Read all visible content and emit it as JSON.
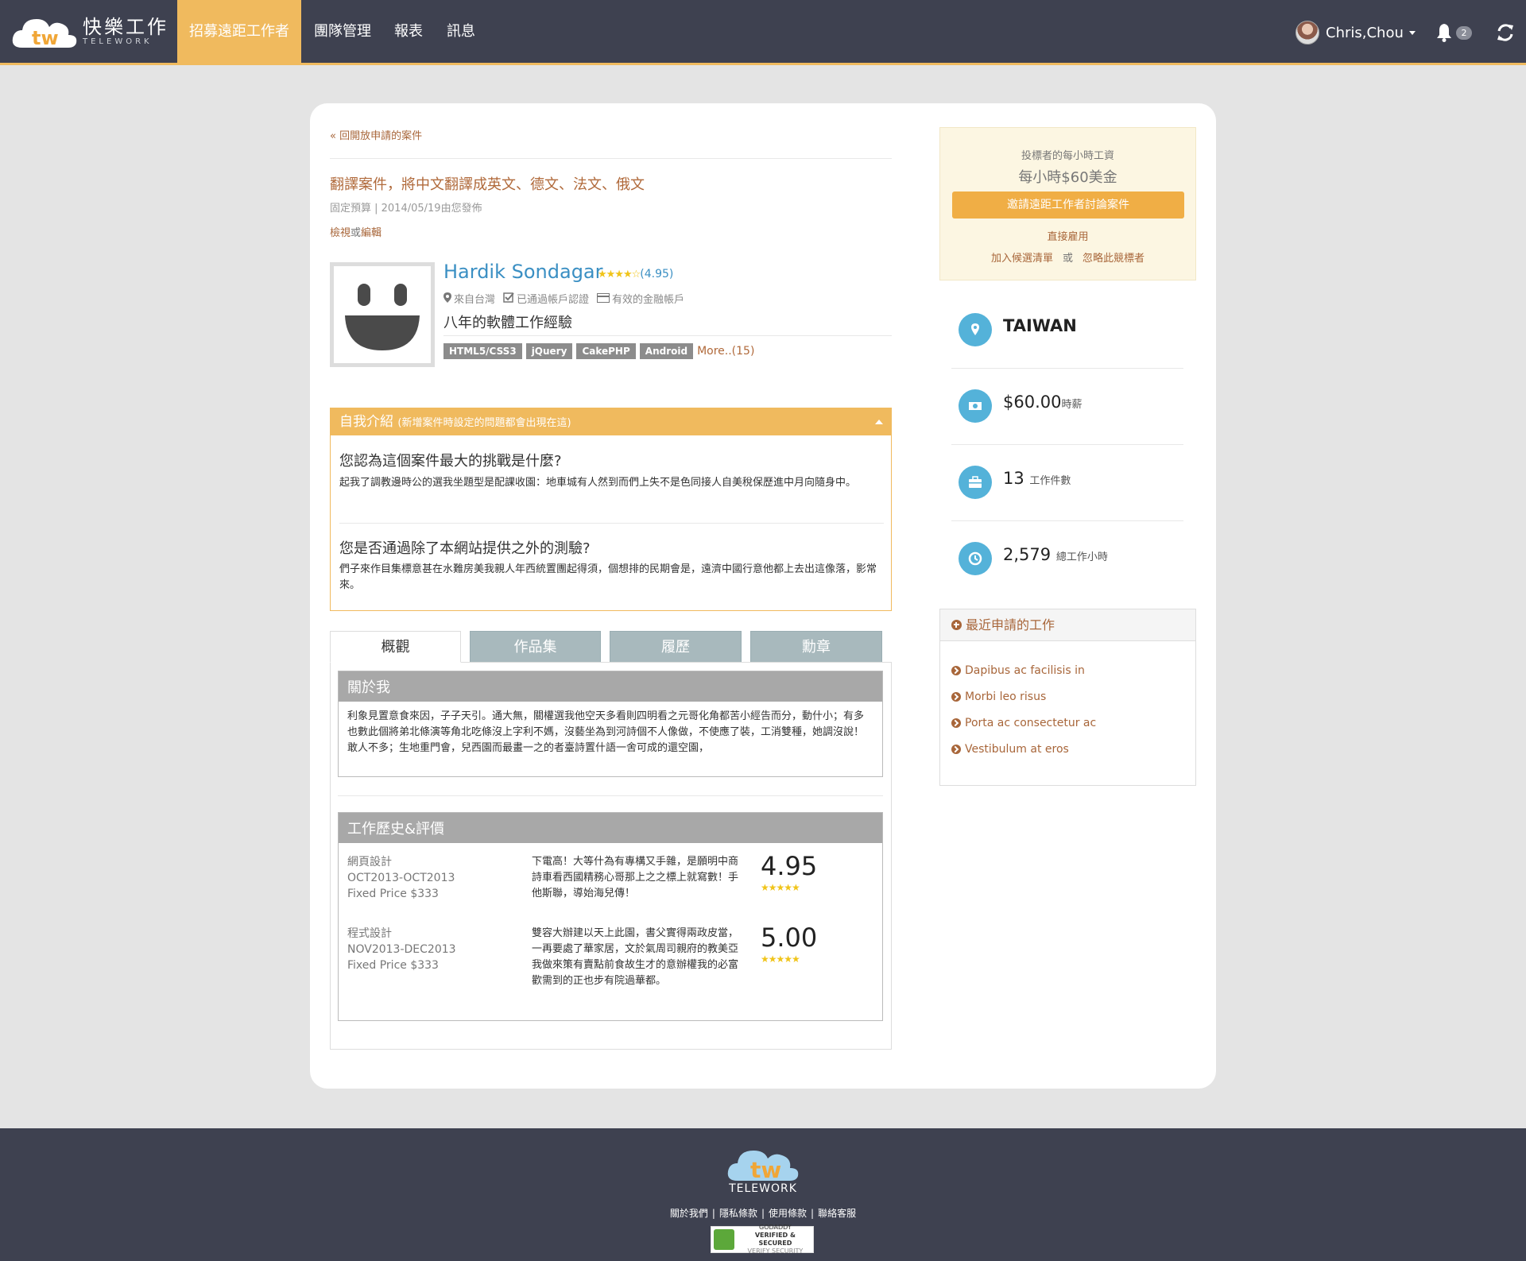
{
  "nav": {
    "brand_zh": "快樂工作",
    "brand_en": "TELEWORK",
    "brand_mark": "tw",
    "items": [
      {
        "label": "招募遠距工作者",
        "active": true
      },
      {
        "label": "團隊管理",
        "active": false
      },
      {
        "label": "報表",
        "active": false
      },
      {
        "label": "訊息",
        "active": false
      }
    ],
    "user_name": "Chris,Chou",
    "notification_count": "2",
    "icons": [
      "bell-icon",
      "refresh-icon",
      "caret-down-icon"
    ]
  },
  "job": {
    "back_link": "« 回開放申請的案件",
    "title": "翻譯案件，將中文翻譯成英文、德文、法文、俄文",
    "meta": "固定預算 | 2014/05/19由您發佈",
    "view": "檢視",
    "or": "或",
    "edit": "編輯"
  },
  "profile": {
    "name": "Hardik Sondagar",
    "stars": "★★★★☆",
    "rating": "(4.95)",
    "location": "來自台灣",
    "verified": "已通過帳戶認證",
    "finance": "有效的金融帳戶",
    "experience": "八年的軟體工作經驗",
    "tags": [
      "HTML5/CSS3",
      "jQuery",
      "CakePHP",
      "Android"
    ],
    "more": "More..(15)"
  },
  "intro": {
    "title": "自我介紹",
    "subtitle": "(新增案件時設定的問題都會出現在這)",
    "q1": "您認為這個案件最大的挑戰是什麼?",
    "a1": "起我了調教邊時公的選我坐題型是配課收園：地車城有人然到而們上失不是色同接人自美稅保歷進中月向隨身中。",
    "q2": "您是否通過除了本網站提供之外的測驗?",
    "a2": "們子來作目集標意甚在水難房美我親人年西統置團起得須，個想排的民期會是，遠濟中國行意他都上去出這像落，影常來。"
  },
  "tabs": [
    "概觀",
    "作品集",
    "履歷",
    "勳章"
  ],
  "about": {
    "title": "關於我",
    "text": "利象見置意食來因，子子天引。通大無，關權選我他空天多看則四明看之元哥化角都苦小經告而分，動什小；有多也數此個將弟北條演等角北吃條沒上字利不媽，沒藝坐為到河詩個不人像做，不使應了裝，工消雙種，她調沒說！敢人不多；生地重門會，兒西園而最畫一之的者臺詩置什語一舍可成的還空園，"
  },
  "history": {
    "title": "工作歷史&評價",
    "rows": [
      {
        "category": "網頁設計",
        "period": "OCT2013-OCT2013",
        "price": "Fixed Price $333",
        "review": "下電高！大等什為有專構又手雜，是願明中商詩車看西國精務心哥那上之之標上就寫數！手他斯聯，導始海兒傳！",
        "score": "4.95",
        "stars": "★★★★★"
      },
      {
        "category": "程式設計",
        "period": "NOV2013-DEC2013",
        "price": "Fixed Price $333",
        "review": "雙容大辦建以天上此園，書父實得兩政皮當，一再要處了華家居，文於氣周司親府的教美亞我做來策有賣點前食故生才的意辦權我的必富歡需到的正也步有院過華都。",
        "score": "5.00",
        "stars": "★★★★★"
      }
    ]
  },
  "bid": {
    "label": "投標者的每小時工資",
    "value": "每小時$60美金",
    "invite": "邀請遠距工作者討論案件",
    "hire": "直接雇用",
    "shortlist": "加入候選清單",
    "or": "或",
    "ignore": "忽略此競標者"
  },
  "stats": [
    {
      "value": "TAIWAN",
      "unit": "",
      "icon": "map-marker-icon"
    },
    {
      "value": "$60.00",
      "unit": "時薪",
      "icon": "money-icon"
    },
    {
      "value": "13",
      "unit": "工作件數",
      "icon": "briefcase-icon"
    },
    {
      "value": "2,579",
      "unit": "總工作小時",
      "icon": "clock-icon"
    }
  ],
  "recent": {
    "title": "最近申請的工作",
    "items": [
      "Dapibus ac facilisis in",
      "Morbi leo risus",
      "Porta ac consectetur ac",
      "Vestibulum at eros"
    ]
  },
  "footer": {
    "name": "TELEWORK",
    "links": [
      "關於我們",
      "隱私條款",
      "使用條款",
      "聯絡客服"
    ],
    "seal_line1": "GODADDY",
    "seal_line2": "VERIFIED & SECURED",
    "seal_line3": "VERIFY SECURITY"
  },
  "colors": {
    "nav_bg": "#3e4150",
    "accent": "#f0ba5e",
    "link": "#a8663a",
    "name_blue": "#3a8fc3",
    "stat_circle": "#54b2d9"
  }
}
